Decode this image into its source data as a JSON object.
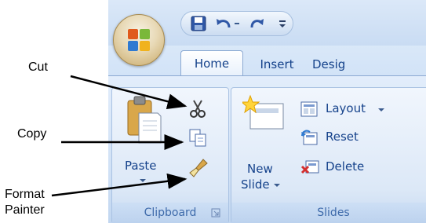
{
  "tabs": [
    {
      "label": "Home",
      "active": true
    },
    {
      "label": "Insert",
      "active": false
    },
    {
      "label": "Desig",
      "active": false
    }
  ],
  "qat": {
    "icons": [
      "save-icon",
      "undo-icon",
      "dropdown-icon",
      "redo-icon",
      "customize-icon"
    ]
  },
  "clipboard": {
    "group_label": "Clipboard",
    "paste_label": "Paste"
  },
  "slides": {
    "group_label": "Slides",
    "new_slide_line1": "New",
    "new_slide_line2": "Slide",
    "layout_label": "Layout",
    "reset_label": "Reset",
    "delete_label": "Delete"
  },
  "annotations": {
    "cut": "Cut",
    "copy": "Copy",
    "format_painter_line1": "Format",
    "format_painter_line2": "Painter"
  },
  "colors": {
    "tab_text": "#15428b",
    "group_label": "#3e6aaa",
    "ribbon_bg": "#d2e3f7"
  }
}
